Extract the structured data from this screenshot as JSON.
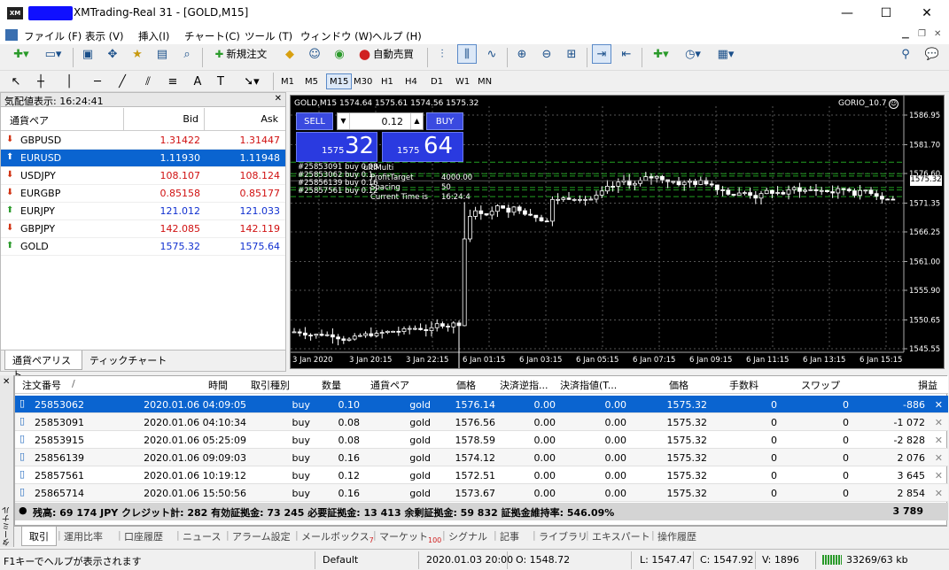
{
  "window": {
    "title": "XMTrading-Real 31 - [GOLD,M15]",
    "minimize": "—",
    "maximize": "☐",
    "close": "✕"
  },
  "menu": [
    "ファイル (F)",
    "表示 (V)",
    "挿入(I)",
    "チャート(C)",
    "ツール (T)",
    "ウィンドウ (W)",
    "ヘルプ (H)"
  ],
  "toolbar": {
    "new_order": "新規注文",
    "auto_trade": "自動売買"
  },
  "timeframes": [
    "M1",
    "M5",
    "M15",
    "M30",
    "H1",
    "H4",
    "D1",
    "W1",
    "MN"
  ],
  "active_timeframe": "M15",
  "market_watch": {
    "header": "気配値表示: 16:24:41",
    "col_symbol": "通貨ペア",
    "col_bid": "Bid",
    "col_ask": "Ask",
    "rows": [
      {
        "symbol": "GBPUSD",
        "bid": "1.31422",
        "ask": "1.31447",
        "dir": "down",
        "color": "#d01010"
      },
      {
        "symbol": "EURUSD",
        "bid": "1.11930",
        "ask": "1.11948",
        "dir": "up",
        "color": "#ffffff"
      },
      {
        "symbol": "USDJPY",
        "bid": "108.107",
        "ask": "108.124",
        "dir": "down",
        "color": "#d01010"
      },
      {
        "symbol": "EURGBP",
        "bid": "0.85158",
        "ask": "0.85177",
        "dir": "down",
        "color": "#d01010"
      },
      {
        "symbol": "EURJPY",
        "bid": "121.012",
        "ask": "121.033",
        "dir": "up",
        "color": "#1030d0"
      },
      {
        "symbol": "GBPJPY",
        "bid": "142.085",
        "ask": "142.119",
        "dir": "down",
        "color": "#d01010"
      },
      {
        "symbol": "GOLD",
        "bid": "1575.32",
        "ask": "1575.64",
        "dir": "up",
        "color": "#1030d0"
      }
    ],
    "tabs": [
      "通貨ペアリスト",
      "ティックチャート"
    ]
  },
  "chart": {
    "header": "GOLD,M15  1574.64 1575.61 1574.56 1575.32",
    "ea_name": "GORIO_10.7",
    "sell_label": "SELL",
    "buy_label": "BUY",
    "lot": "0.12",
    "sell_big": "32",
    "sell_small": "1575",
    "buy_big": "64",
    "buy_small": "1575",
    "comments": [
      "#25853091 buy 0.08",
      "#25853062 buy 0.1",
      "#25856139 buy 0.16",
      "#25857561 buy 0.12"
    ],
    "info": [
      [
        "ProfitTarget",
        "4000.00"
      ],
      [
        "Spacing",
        "50"
      ],
      [
        "Current Time is",
        "16:24:4"
      ]
    ],
    "overlay_label": "ultiMulti",
    "price_tag": "1575.32",
    "y_labels": [
      "1586.95",
      "1581.70",
      "1576.60",
      "1571.35",
      "1566.25",
      "1561.00",
      "1555.90",
      "1550.65",
      "1545.55"
    ],
    "x_labels": [
      "3 Jan 2020",
      "3 Jan 20:15",
      "3 Jan 22:15",
      "6 Jan 01:15",
      "6 Jan 03:15",
      "6 Jan 05:15",
      "6 Jan 07:15",
      "6 Jan 09:15",
      "6 Jan 11:15",
      "6 Jan 13:15",
      "6 Jan 15:15"
    ]
  },
  "chart_data": {
    "type": "candlestick",
    "ylim": [
      1545.55,
      1586.95
    ],
    "last": 1575.32
  },
  "terminal": {
    "side_label": "ターミナル",
    "columns": [
      "注文番号",
      "時間",
      "取引種別",
      "数量",
      "通貨ペア",
      "価格",
      "決済逆指...",
      "決済指値(T...",
      "価格",
      "手数料",
      "スワップ",
      "損益"
    ],
    "rows": [
      [
        "25853062",
        "2020.01.06 04:09:05",
        "buy",
        "0.10",
        "gold",
        "1576.14",
        "0.00",
        "0.00",
        "1575.32",
        "0",
        "0",
        "-886"
      ],
      [
        "25853091",
        "2020.01.06 04:10:34",
        "buy",
        "0.08",
        "gold",
        "1576.56",
        "0.00",
        "0.00",
        "1575.32",
        "0",
        "0",
        "-1 072"
      ],
      [
        "25853915",
        "2020.01.06 05:25:09",
        "buy",
        "0.08",
        "gold",
        "1578.59",
        "0.00",
        "0.00",
        "1575.32",
        "0",
        "0",
        "-2 828"
      ],
      [
        "25856139",
        "2020.01.06 09:09:03",
        "buy",
        "0.16",
        "gold",
        "1574.12",
        "0.00",
        "0.00",
        "1575.32",
        "0",
        "0",
        "2 076"
      ],
      [
        "25857561",
        "2020.01.06 10:19:12",
        "buy",
        "0.12",
        "gold",
        "1572.51",
        "0.00",
        "0.00",
        "1575.32",
        "0",
        "0",
        "3 645"
      ],
      [
        "25865714",
        "2020.01.06 15:50:56",
        "buy",
        "0.16",
        "gold",
        "1573.67",
        "0.00",
        "0.00",
        "1575.32",
        "0",
        "0",
        "2 854"
      ]
    ],
    "summary": "残高: 69 174 JPY  クレジット計: 282  有効証拠金: 73 245  必要証拠金: 13 413  余剰証拠金: 59 832  証拠金維持率: 546.09%",
    "total": "3 789",
    "tabs": [
      [
        "取引",
        ""
      ],
      [
        "運用比率",
        ""
      ],
      [
        "口座履歴",
        ""
      ],
      [
        "ニュース",
        ""
      ],
      [
        "アラーム設定",
        ""
      ],
      [
        "メールボックス",
        "7"
      ],
      [
        "マーケット",
        "100"
      ],
      [
        "シグナル",
        ""
      ],
      [
        "記事",
        ""
      ],
      [
        "ライブラリ",
        ""
      ],
      [
        "エキスパート",
        ""
      ],
      [
        "操作履歴",
        ""
      ]
    ]
  },
  "status": {
    "help": "F1キーでヘルプが表示されます",
    "profile": "Default",
    "date": "2020.01.03 20:00",
    "open": "O: 1548.72",
    "low": "L: 1547.47",
    "close": "C: 1547.92",
    "volume": "V: 1896",
    "traffic": "33269/63 kb"
  }
}
